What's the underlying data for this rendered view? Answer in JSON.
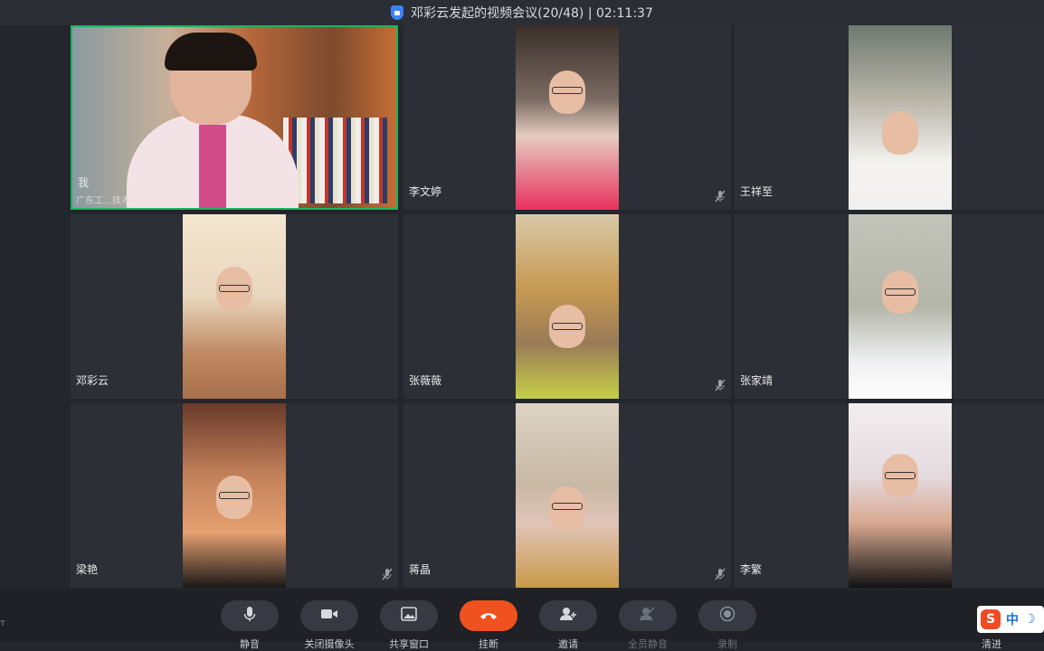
{
  "title": {
    "text": "邓彩云发起的视频会议(20/48) | 02:11:37"
  },
  "participants": [
    {
      "name": "我",
      "subtitle": "广东工…技术…",
      "muted": false
    },
    {
      "name": "李文婷",
      "muted": true
    },
    {
      "name": "王祥至",
      "muted": false
    },
    {
      "name": "邓彩云",
      "muted": false
    },
    {
      "name": "张薇薇",
      "muted": true
    },
    {
      "name": "张家靖",
      "muted": false
    },
    {
      "name": "梁艳",
      "muted": true
    },
    {
      "name": "蒋晶",
      "muted": true
    },
    {
      "name": "李繁",
      "muted": false
    }
  ],
  "toolbar": {
    "mute": "静音",
    "camera": "关闭摄像头",
    "share": "共享窗口",
    "hangup": "挂断",
    "invite": "邀请",
    "mute_all": "全员静音",
    "record": "录制"
  },
  "ime": {
    "zh": "中",
    "moon": "☽"
  },
  "bottom_right_label": "清进",
  "corner_text": "т",
  "colors": {
    "active_border": "#19b563",
    "hangup": "#f0521f",
    "background": "#23262d"
  }
}
